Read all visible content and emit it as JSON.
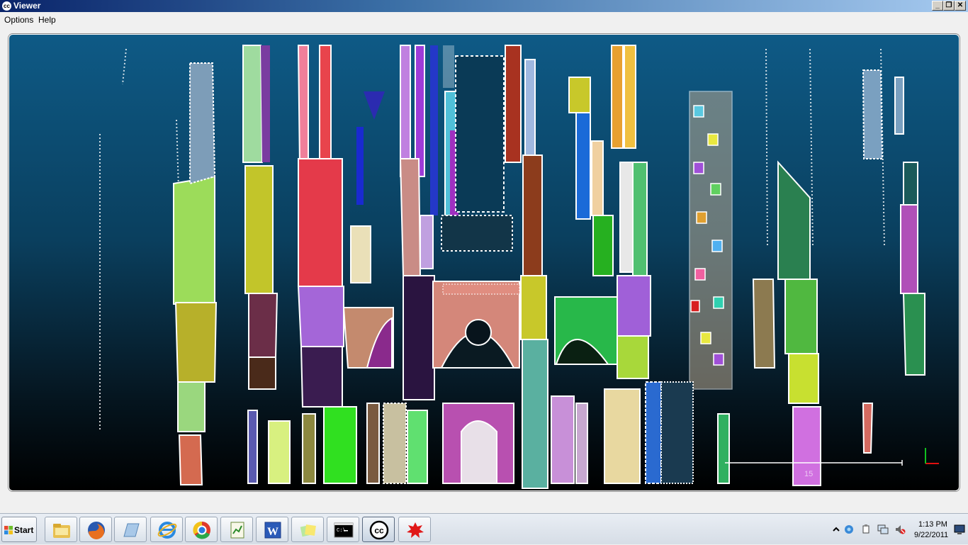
{
  "window": {
    "app_icon_text": "cc",
    "title": "Viewer",
    "buttons": {
      "minimize": "_",
      "restore": "❐",
      "close": "✕"
    }
  },
  "menubar": {
    "items": [
      "Options",
      "Help"
    ]
  },
  "viewer": {
    "scale_label": "15",
    "axis_colors": {
      "x": "#e01010",
      "y": "#10c020"
    },
    "background_top": "#0e5a86",
    "background_bottom": "#000000"
  },
  "taskbar": {
    "start_label": "Start",
    "pinned_icons": [
      "file-explorer-icon",
      "firefox-icon",
      "notes-icon",
      "internet-explorer-icon",
      "chrome-icon",
      "notepad-icon",
      "word-icon",
      "sticky-notes-icon",
      "command-prompt-icon",
      "cloudcompare-icon",
      "splash-app-icon"
    ],
    "tray_icons": [
      "show-hidden-icons-icon",
      "network-status-icon",
      "usb-icon",
      "network-icon",
      "volume-muted-icon"
    ],
    "clock_time": "1:13 PM",
    "clock_date": "9/22/2011",
    "show_desktop_icon": "show-desktop-icon"
  }
}
